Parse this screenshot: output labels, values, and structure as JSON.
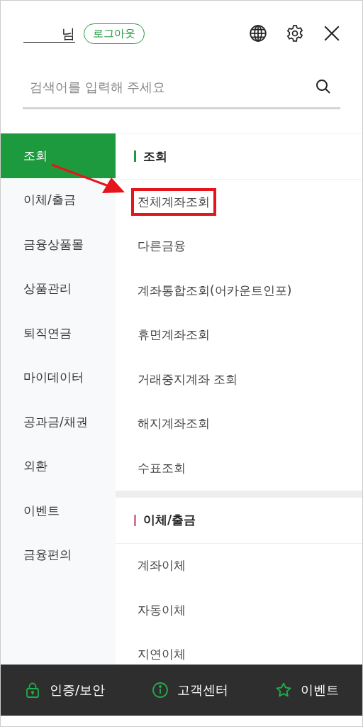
{
  "header": {
    "user_suffix": "님",
    "logout": "로그아웃"
  },
  "search": {
    "placeholder": "검색어를 입력해 주세요"
  },
  "categories": [
    {
      "label": "조회",
      "selected": true
    },
    {
      "label": "이체/출금",
      "selected": false
    },
    {
      "label": "금융상품몰",
      "selected": false
    },
    {
      "label": "상품관리",
      "selected": false
    },
    {
      "label": "퇴직연금",
      "selected": false
    },
    {
      "label": "마이데이터",
      "selected": false
    },
    {
      "label": "공과금/채권",
      "selected": false
    },
    {
      "label": "외환",
      "selected": false
    },
    {
      "label": "이벤트",
      "selected": false
    },
    {
      "label": "금융편의",
      "selected": false
    }
  ],
  "sections": [
    {
      "title": "조회",
      "color": "#1e9a3e",
      "items": [
        {
          "label": "전체계좌조회",
          "highlighted": true
        },
        {
          "label": "다른금융",
          "highlighted": false
        },
        {
          "label": "계좌통합조회(어카운트인포)",
          "highlighted": false
        },
        {
          "label": "휴면계좌조회",
          "highlighted": false
        },
        {
          "label": "거래중지계좌 조회",
          "highlighted": false
        },
        {
          "label": "해지계좌조회",
          "highlighted": false
        },
        {
          "label": "수표조회",
          "highlighted": false
        }
      ]
    },
    {
      "title": "이체/출금",
      "color": "#d07a9a",
      "items": [
        {
          "label": "계좌이체",
          "highlighted": false
        },
        {
          "label": "자동이체",
          "highlighted": false
        },
        {
          "label": "지연이체",
          "highlighted": false
        }
      ]
    }
  ],
  "bottom_bar": [
    {
      "kind": "lock",
      "label": "인증/보안"
    },
    {
      "kind": "info",
      "label": "고객센터"
    },
    {
      "kind": "star",
      "label": "이벤트"
    }
  ]
}
